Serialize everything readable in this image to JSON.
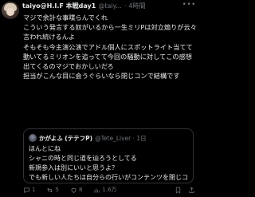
{
  "post": {
    "display_name": "taiyo@H.I.F 本戦day1",
    "handle": "@taiy...",
    "separator": "·",
    "time": "4時間",
    "body": "マジで余計な事喋らんでくれ\nこういう発言する奴がいるから一生ミリPは対立煽りが云々言われ続けるんよ\nそもそも今主演公演でアドル個人にスポットライト当てて動いてるミリオンを追ってて今回の騒動に対してこの感想出てくるのマジでおかしいだろ\n担当がこんな目に会うぐらいなら閉じコンで結構です"
  },
  "quote": {
    "name": "かがよふ (テテフP)",
    "handle": "@Tete_Liver · 1日",
    "body": "ほんとにね\nシャニの時と同じ道を辿ろうとしてる\n新規参入は別にいいと思うよ？\nでも新しい人たちは自分らの行いがコンテンツを閉じコンにしてる事に気付いてない..."
  },
  "actions": {
    "reply_count": "1",
    "repost_count": "5",
    "like_count": "8",
    "views_count": "1.6万"
  },
  "icons": [
    "more-icon",
    "reply-icon",
    "repost-icon",
    "like-icon",
    "views-icon",
    "bookmark-icon",
    "share-icon"
  ]
}
